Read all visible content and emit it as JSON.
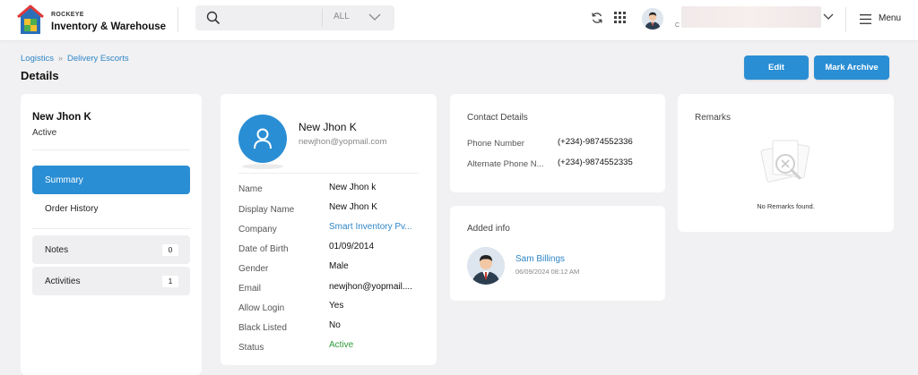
{
  "header": {
    "brand_small": "ROCKEYE",
    "brand_big": "Inventory & Warehouse",
    "search_placeholder": "",
    "search_filter": "ALL",
    "menu_label": "Menu",
    "user_company_hint": "C"
  },
  "breadcrumb": {
    "items": [
      "Logistics",
      "Delivery Escorts"
    ]
  },
  "page": {
    "title": "Details",
    "edit_label": "Edit",
    "archive_label": "Mark Archive"
  },
  "profile_nav": {
    "name": "New Jhon K",
    "status": "Active",
    "items": [
      {
        "label": "Summary"
      },
      {
        "label": "Order History"
      },
      {
        "label": "Notes",
        "count": "0"
      },
      {
        "label": "Activities",
        "count": "1"
      }
    ]
  },
  "summary": {
    "name": "New Jhon K",
    "email": "newjhon@yopmail.com",
    "fields": [
      {
        "label": "Name",
        "value": "New Jhon k"
      },
      {
        "label": "Display Name",
        "value": "New Jhon K"
      },
      {
        "label": "Company",
        "value": "Smart Inventory Pv..."
      },
      {
        "label": "Date of Birth",
        "value": "01/09/2014"
      },
      {
        "label": "Gender",
        "value": "Male"
      },
      {
        "label": "Email",
        "value": "newjhon@yopmail...."
      },
      {
        "label": "Allow Login",
        "value": "Yes"
      },
      {
        "label": "Black Listed",
        "value": "No"
      },
      {
        "label": "Status",
        "value": "Active"
      }
    ]
  },
  "contact": {
    "title": "Contact Details",
    "phone_label": "Phone Number",
    "phone_value": "(+234)-9874552336",
    "alt_phone_label": "Alternate Phone N...",
    "alt_phone_value": "(+234)-9874552335"
  },
  "added_info": {
    "title": "Added info",
    "user": "Sam Billings",
    "timestamp": "06/09/2024 08:12 AM"
  },
  "remarks": {
    "title": "Remarks",
    "empty_text": "No Remarks found."
  },
  "colors": {
    "primary": "#2a8ed4",
    "link": "#2f86c6",
    "success": "#2e9b3a",
    "background": "#f1f1f3"
  },
  "icons": [
    "logo-house-icon",
    "search-icon",
    "chevron-down-icon",
    "refresh-icon",
    "apps-grid-icon",
    "hamburger-menu-icon",
    "user-icon",
    "no-remarks-illustration-icon"
  ]
}
